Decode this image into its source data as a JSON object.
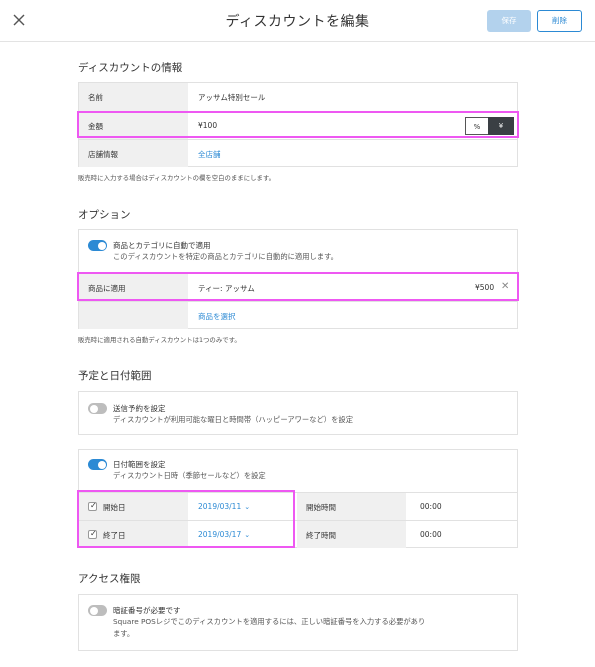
{
  "header": {
    "title": "ディスカウントを編集",
    "save_label": "保存",
    "delete_label": "削除"
  },
  "discount_info": {
    "section_title": "ディスカウントの情報",
    "name_label": "名前",
    "name_value": "アッサム特別セール",
    "amount_label": "金額",
    "amount_value": "¥100",
    "percent_option": "%",
    "yen_option": "¥",
    "store_label": "店舗情報",
    "store_value": "全店舗",
    "hint": "販売時に入力する場合はディスカウントの欄を空白のままにします。"
  },
  "options": {
    "section_title": "オプション",
    "auto_apply_title": "商品とカテゴリに自動で適用",
    "auto_apply_desc": "このディスカウントを特定の商品とカテゴリに自動的に適用します。",
    "apply_label": "商品に適用",
    "applied_item_name": "ティー: アッサム",
    "applied_item_price": "¥500",
    "select_items_link": "商品を選択",
    "hint": "販売時に適用される自動ディスカウントは1つのみです。"
  },
  "schedule": {
    "section_title": "予定と日付範囲",
    "scheduled_title": "送信予約を設定",
    "scheduled_desc": "ディスカウントが利用可能な曜日と時間帯（ハッピーアワーなど）を設定",
    "date_range_title": "日付範囲を設定",
    "date_range_desc": "ディスカウント日時（季節セールなど）を設定",
    "start_date_label": "開始日",
    "start_date_value": "2019/03/11",
    "end_date_label": "終了日",
    "end_date_value": "2019/03/17",
    "start_time_label": "開始時間",
    "start_time_value": "00:00",
    "end_time_label": "終了時間",
    "end_time_value": "00:00"
  },
  "access": {
    "section_title": "アクセス権限",
    "pin_title": "暗証番号が必要です",
    "pin_desc_line1": "Square POSレジでこのディスカウントを適用するには、正しい暗証番号を入力する必要があり",
    "pin_desc_line2": "ます。"
  },
  "colors": {
    "accent": "#2c8ad4",
    "highlight": "#ee58f2",
    "save_disabled": "#b3d2ed",
    "toggle_off": "#bdbdbd"
  }
}
